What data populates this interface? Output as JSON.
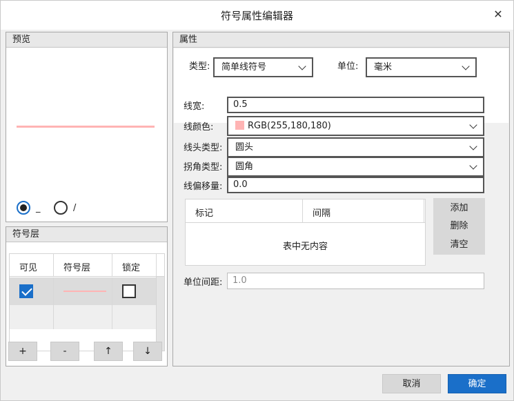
{
  "window": {
    "title": "符号属性编辑器",
    "close_glyph": "✕"
  },
  "preview": {
    "header": "预览",
    "line_color": "#ffb4b4",
    "options": [
      {
        "label": "_",
        "selected": true
      },
      {
        "label": "/",
        "selected": false
      }
    ]
  },
  "layers": {
    "header": "符号层",
    "columns": [
      "可见",
      "符号层",
      "锁定"
    ],
    "rows": [
      {
        "visible": true,
        "locked": false,
        "symbol_color": "#ffb4b4"
      }
    ],
    "buttons": [
      "+",
      "-",
      "↑",
      "↓"
    ]
  },
  "properties": {
    "header": "属性",
    "type_label": "类型:",
    "type_value": "简单线符号",
    "unit_label": "单位:",
    "unit_value": "毫米",
    "width_label": "线宽:",
    "width_value": "0.5",
    "color_label": "线颜色:",
    "color_value": "RGB(255,180,180)",
    "color_hex": "#ffb4b4",
    "cap_label": "线头类型:",
    "cap_value": "圆头",
    "join_label": "拐角类型:",
    "join_value": "圆角",
    "offset_label": "线偏移量:",
    "offset_value": "0.0",
    "marker_columns": [
      "标记",
      "间隔"
    ],
    "marker_empty": "表中无内容",
    "marker_buttons": [
      "添加",
      "删除",
      "清空"
    ],
    "spacing_label": "单位间距:",
    "spacing_value": "1.0"
  },
  "footer": {
    "cancel": "取消",
    "ok": "确定"
  }
}
